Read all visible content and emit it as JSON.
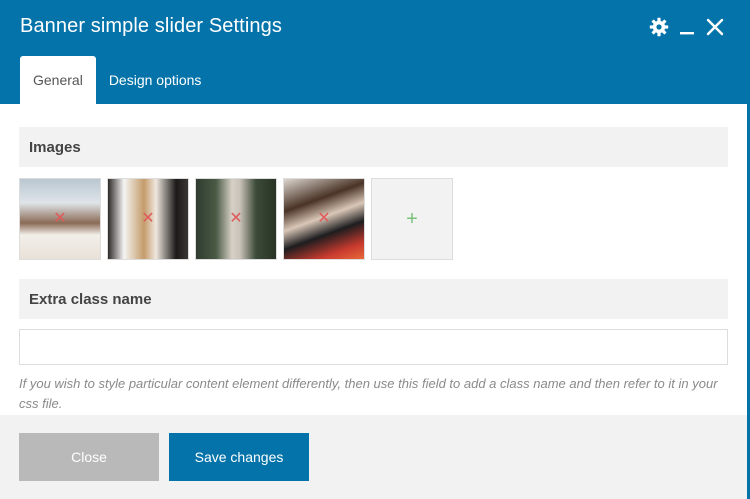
{
  "dialog": {
    "title": "Banner simple slider Settings",
    "icons": [
      "gear-icon",
      "minimize-icon",
      "close-icon"
    ]
  },
  "tabs": [
    {
      "label": "General",
      "active": true
    },
    {
      "label": "Design options",
      "active": false
    }
  ],
  "images_section": {
    "title": "Images",
    "thumbnails": [
      {
        "alt": "image-1",
        "remove_glyph": "✕"
      },
      {
        "alt": "image-2",
        "remove_glyph": "✕"
      },
      {
        "alt": "image-3",
        "remove_glyph": "✕"
      },
      {
        "alt": "image-4",
        "remove_glyph": "✕"
      }
    ],
    "add_glyph": "+"
  },
  "extra_class": {
    "title": "Extra class name",
    "value": "",
    "placeholder": "",
    "help": "If you wish to style particular content element differently, then use this field to add a class name and then refer to it in your css file."
  },
  "footer": {
    "close_label": "Close",
    "save_label": "Save changes"
  },
  "colors": {
    "accent": "#0473aa",
    "close_button": "#b9b9b9",
    "section_bg": "#f2f2f2",
    "remove_icon": "#e05a5a",
    "add_icon": "#7ac27a"
  }
}
